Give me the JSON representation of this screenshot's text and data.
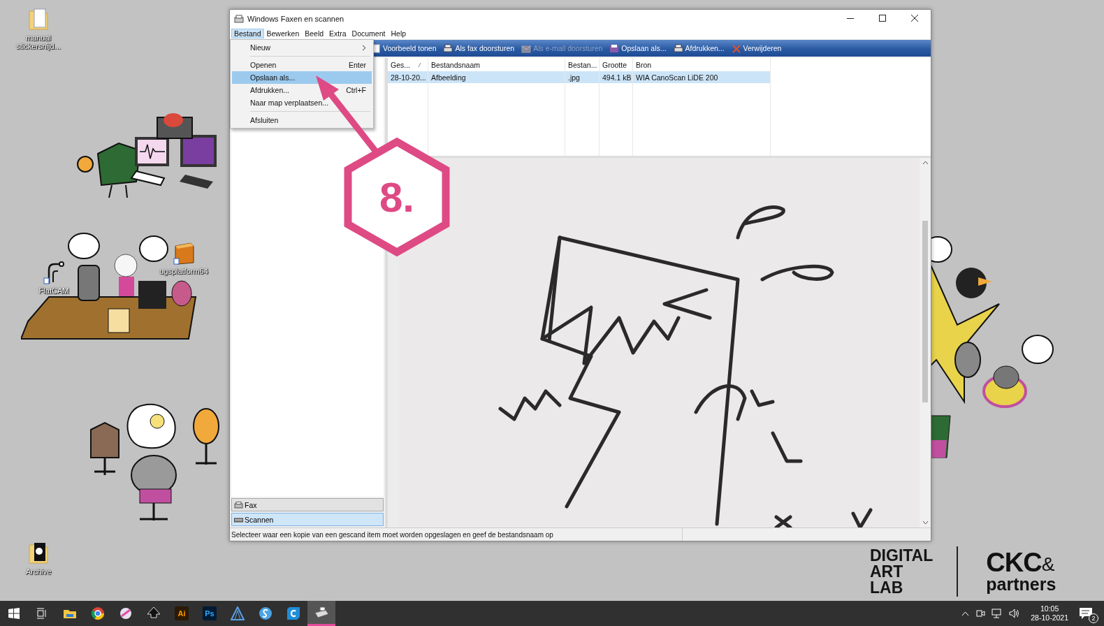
{
  "desktop_icons": [
    {
      "label": "manual stickersnijd...",
      "kind": "folder-doc"
    },
    {
      "label": "FlatCAM",
      "kind": "flatcam"
    },
    {
      "label": "ugsplatform64",
      "kind": "cube"
    },
    {
      "label": "Archive",
      "kind": "folder-archive"
    }
  ],
  "window": {
    "title": "Windows Faxen en scannen",
    "menu": [
      {
        "label": "Bestand",
        "selected": true
      },
      {
        "label": "Bewerken",
        "selected": false
      },
      {
        "label": "Beeld",
        "selected": false
      },
      {
        "label": "Extra",
        "selected": false
      },
      {
        "label": "Document",
        "selected": false
      },
      {
        "label": "Help",
        "selected": false
      }
    ],
    "file_menu": [
      {
        "kind": "item",
        "label": "Nieuw",
        "submenu": true,
        "selected": false
      },
      {
        "kind": "separator"
      },
      {
        "kind": "item",
        "label": "Openen",
        "shortcut": "Enter",
        "submenu": false,
        "selected": false
      },
      {
        "kind": "item",
        "label": "Opslaan als...",
        "submenu": false,
        "selected": true
      },
      {
        "kind": "item",
        "label": "Afdrukken...",
        "shortcut": "Ctrl+F",
        "submenu": false,
        "selected": false
      },
      {
        "kind": "item",
        "label": "Naar map verplaatsen...",
        "submenu": false,
        "selected": false
      },
      {
        "kind": "separator"
      },
      {
        "kind": "item",
        "label": "Afsluiten",
        "submenu": false,
        "selected": false
      }
    ],
    "toolbar": [
      {
        "kind": "preview",
        "label": "Voorbeeld tonen",
        "disabled": false
      },
      {
        "kind": "fax",
        "label": "Als fax doorsturen",
        "disabled": false
      },
      {
        "kind": "email",
        "label": "Als e-mail doorsturen",
        "disabled": true
      },
      {
        "kind": "save",
        "label": "Opslaan als...",
        "disabled": false
      },
      {
        "kind": "print",
        "label": "Afdrukken...",
        "disabled": false
      },
      {
        "kind": "delete",
        "label": "Verwijderen",
        "disabled": false
      }
    ],
    "pane_buttons": [
      {
        "kind": "fax",
        "label": "Fax",
        "selected": false
      },
      {
        "kind": "scan",
        "label": "Scannen",
        "selected": true
      }
    ],
    "table": {
      "columns": [
        "Ges...",
        "Bestandsnaam",
        "Bestan...",
        "Grootte",
        "Bron"
      ],
      "rows": [
        {
          "cells": [
            "28-10-20...",
            "Afbeelding",
            ".jpg",
            "494.1 kB",
            "WIA CanoScan LiDE 200"
          ],
          "selected": true
        }
      ]
    },
    "status_bar": "Selecteer waar een kopie van een gescand item moet worden opgeslagen en geef de bestandsnaam op"
  },
  "annotation": {
    "step": "8."
  },
  "logos": {
    "lab_lines": [
      "DIGITAL",
      "ART",
      "LAB"
    ],
    "ckc": "CKC",
    "amp": "&",
    "partners": "partners"
  },
  "taskbar": {
    "apps": [
      {
        "kind": "start",
        "selected": false
      },
      {
        "kind": "task-view",
        "selected": false
      },
      {
        "kind": "explorer",
        "selected": false
      },
      {
        "kind": "chrome",
        "selected": false
      },
      {
        "kind": "paint",
        "selected": false
      },
      {
        "kind": "inkscape",
        "selected": false
      },
      {
        "kind": "illustrator",
        "label": "Ai",
        "selected": false
      },
      {
        "kind": "photoshop",
        "label": "Ps",
        "selected": false
      },
      {
        "kind": "triangle",
        "selected": false
      },
      {
        "kind": "sketch",
        "selected": false
      },
      {
        "kind": "cura",
        "selected": false
      },
      {
        "kind": "fax",
        "selected": true
      }
    ],
    "time": "10:05",
    "date": "28-10-2021",
    "notifications": "2"
  }
}
